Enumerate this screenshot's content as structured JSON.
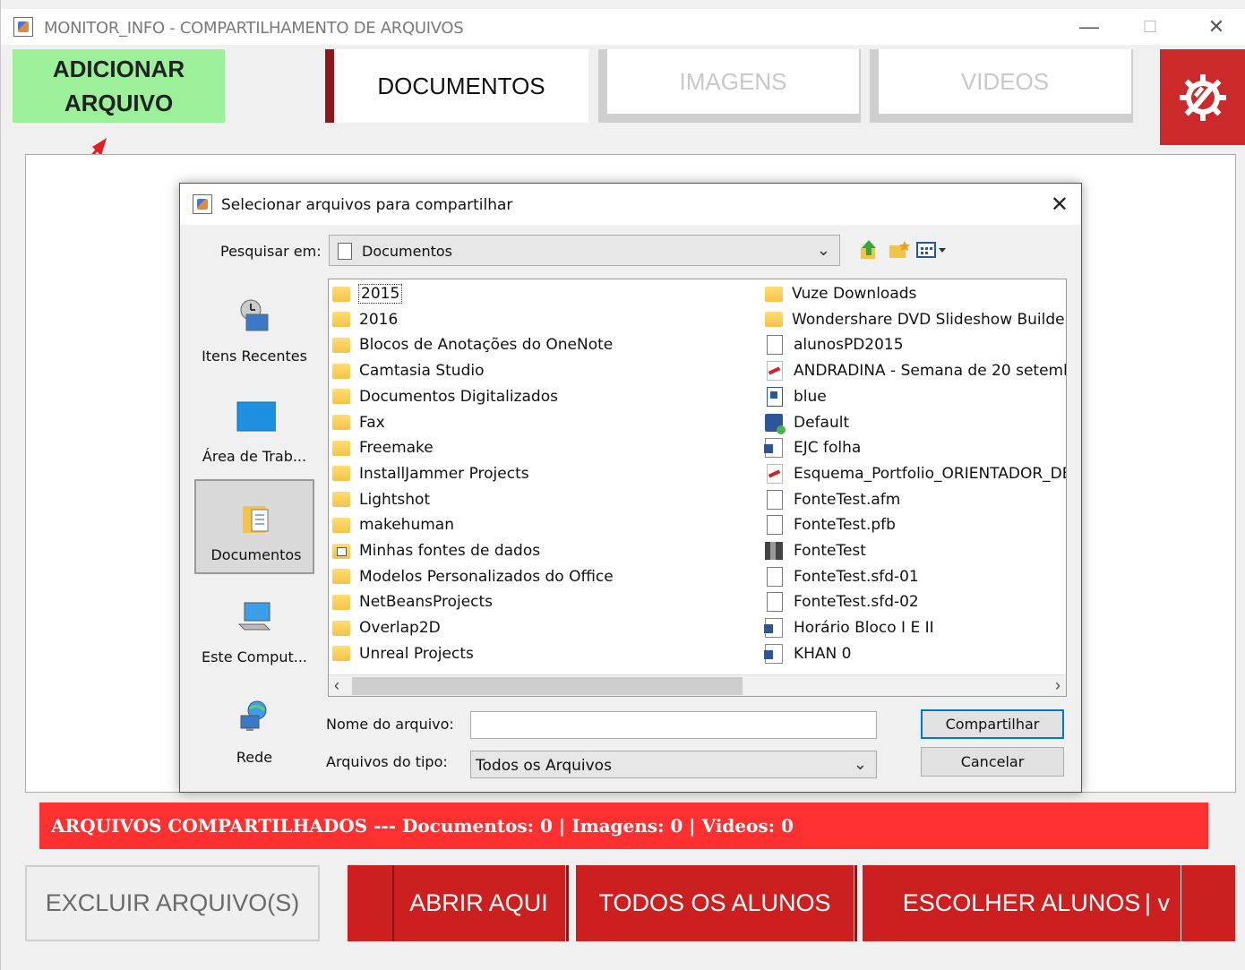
{
  "window": {
    "title": "MONITOR_INFO - COMPARTILHAMENTO DE ARQUIVOS",
    "min_glyph": "—",
    "max_glyph": "☐",
    "close_glyph": "✕"
  },
  "toolbar": {
    "add_file_label": "ADICIONAR\nARQUIVO",
    "tabs": [
      {
        "label": "DOCUMENTOS",
        "active": true
      },
      {
        "label": "IMAGENS",
        "active": false
      },
      {
        "label": "VIDEOS",
        "active": false
      }
    ],
    "settings_icon": "gear-wrench-icon"
  },
  "dialog": {
    "title": "Selecionar arquivos para compartilhar",
    "lookin_label": "Pesquisar em:",
    "lookin_value": "Documentos",
    "places": [
      {
        "label": "Itens Recentes",
        "icon": "recent-items-icon"
      },
      {
        "label": "Área de Trab...",
        "icon": "desktop-icon"
      },
      {
        "label": "Documentos",
        "icon": "documents-icon",
        "selected": true
      },
      {
        "label": "Este Comput...",
        "icon": "computer-icon"
      },
      {
        "label": "Rede",
        "icon": "network-icon"
      }
    ],
    "files_col1": [
      {
        "name": "2015",
        "type": "folder"
      },
      {
        "name": "2016",
        "type": "folder"
      },
      {
        "name": "Blocos de Anotações do OneNote",
        "type": "folder"
      },
      {
        "name": "Camtasia Studio",
        "type": "folder"
      },
      {
        "name": "Documentos Digitalizados",
        "type": "folder"
      },
      {
        "name": "Fax",
        "type": "folder"
      },
      {
        "name": "Freemake",
        "type": "folder"
      },
      {
        "name": "InstallJammer Projects",
        "type": "folder"
      },
      {
        "name": "Lightshot",
        "type": "folder"
      },
      {
        "name": "makehuman",
        "type": "folder"
      },
      {
        "name": "Minhas fontes de dados",
        "type": "datafolder"
      },
      {
        "name": "Modelos Personalizados do Office",
        "type": "folder"
      },
      {
        "name": "NetBeansProjects",
        "type": "folder"
      },
      {
        "name": "Overlap2D",
        "type": "folder"
      },
      {
        "name": "Unreal Projects",
        "type": "folder"
      }
    ],
    "files_col2": [
      {
        "name": "Vuze Downloads",
        "type": "folder"
      },
      {
        "name": "Wondershare DVD Slideshow Builder",
        "type": "folder"
      },
      {
        "name": "alunosPD2015",
        "type": "file"
      },
      {
        "name": "ANDRADINA - Semana de 20 setemb",
        "type": "pdf"
      },
      {
        "name": "blue",
        "type": "img"
      },
      {
        "name": "Default",
        "type": "link"
      },
      {
        "name": "EJC folha",
        "type": "word"
      },
      {
        "name": "Esquema_Portfolio_ORIENTADOR_DE",
        "type": "pdf"
      },
      {
        "name": "FonteTest.afm",
        "type": "file"
      },
      {
        "name": "FonteTest.pfb",
        "type": "file"
      },
      {
        "name": "FonteTest",
        "type": "font"
      },
      {
        "name": "FonteTest.sfd-01",
        "type": "file"
      },
      {
        "name": "FonteTest.sfd-02",
        "type": "file"
      },
      {
        "name": "Horário Bloco I E II",
        "type": "word"
      },
      {
        "name": "KHAN 0",
        "type": "word"
      }
    ],
    "filename_label": "Nome do arquivo:",
    "filename_value": "",
    "filetype_label": "Arquivos do tipo:",
    "filetype_value": "Todos os Arquivos",
    "share_button": "Compartilhar",
    "cancel_button": "Cancelar"
  },
  "status": {
    "text": "ARQUIVOS COMPARTILHADOS --- Documentos: 0  |  Imagens: 0  |  Videos: 0"
  },
  "actions": {
    "delete_label": "EXCLUIR ARQUIVO(S)",
    "open_here_label": "ABRIR AQUI",
    "all_students_label": "TODOS OS ALUNOS",
    "choose_students_label": "ESCOLHER ALUNOS",
    "dropdown_glyph": "|  v"
  },
  "colors": {
    "accent_green": "#9cf09a",
    "accent_red": "#cc2020",
    "status_red": "#ff3030"
  }
}
